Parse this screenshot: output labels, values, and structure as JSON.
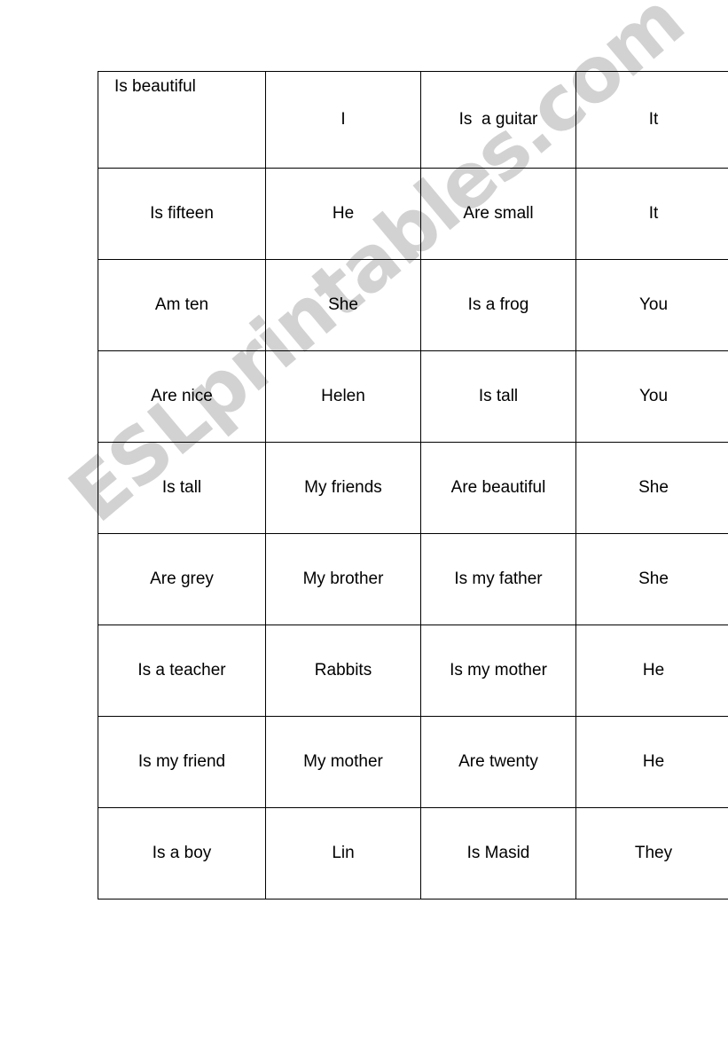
{
  "page": {
    "background_color": "#ffffff",
    "text_color": "#000000",
    "border_color": "#000000"
  },
  "watermark": {
    "text": "ESLprintables.com",
    "color": "#d2d2d2",
    "rotation_degrees": -40
  },
  "table": {
    "columns": 4,
    "rows": 9,
    "rows_data": [
      [
        "Is beautiful",
        "I",
        "Is  a guitar",
        "It"
      ],
      [
        "Is fifteen",
        "He",
        "Are small",
        "It"
      ],
      [
        "Am ten",
        "She",
        "Is a frog",
        "You"
      ],
      [
        "Are nice",
        "Helen",
        "Is tall",
        "You"
      ],
      [
        "Is tall",
        "My friends",
        "Are beautiful",
        "She"
      ],
      [
        "Are grey",
        "My brother",
        "Is my father",
        "She"
      ],
      [
        "Is a teacher",
        "Rabbits",
        "Is my mother",
        "He"
      ],
      [
        "Is my friend",
        "My mother",
        "Are twenty",
        "He"
      ],
      [
        "Is a boy",
        "Lin",
        "Is Masid",
        "They"
      ]
    ]
  }
}
